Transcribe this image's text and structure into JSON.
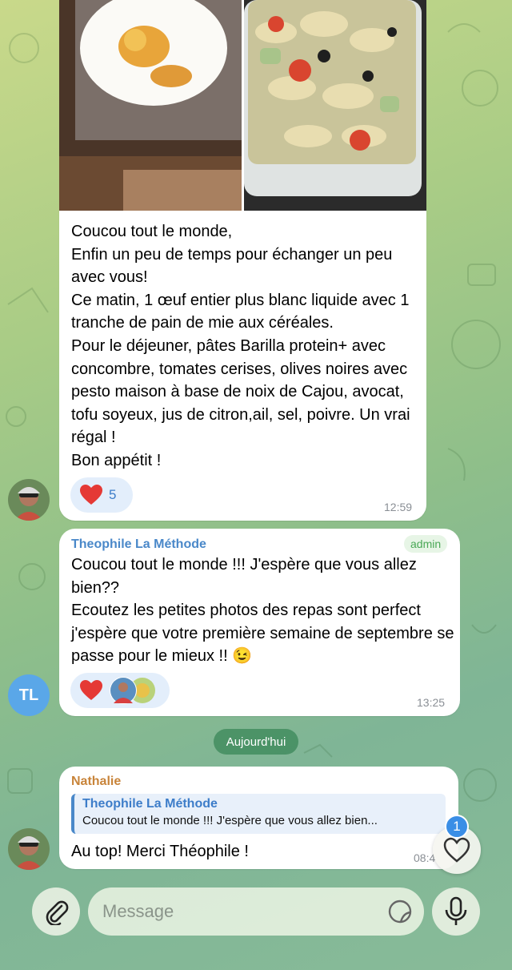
{
  "messages": [
    {
      "id": "m1",
      "text": "Coucou tout le monde,\nEnfin un peu de temps pour  échanger un peu avec vous!\nCe matin, 1 œuf entier plus blanc liquide avec 1 tranche de pain de mie aux céréales.\nPour le déjeuner, pâtes Barilla protein+ avec concombre, tomates cerises, olives noires avec pesto maison à base de noix de Cajou, avocat, tofu soyeux, jus de citron,ail, sel, poivre. Un vrai régal !\nBon appétit !",
      "reaction_count": "5",
      "time": "12:59"
    },
    {
      "id": "m2",
      "sender": "Theophile La Méthode",
      "badge": "admin",
      "text": "Coucou tout le monde !!! J'espère que vous allez bien??\nEcoutez les petites photos des repas sont perfect j'espère que votre première semaine de septembre se passe pour le mieux !! 😉",
      "time": "13:25"
    },
    {
      "id": "m3",
      "sender": "Nathalie",
      "reply_to_name": "Theophile La Méthode",
      "reply_to_text": "Coucou tout le monde !!! J'espère que vous allez bien...",
      "text": "Au top! Merci Théophile !",
      "time": "08:4"
    }
  ],
  "avatar_initials": "TL",
  "date_separator": "Aujourd'hui",
  "reactions_badge": "1",
  "composer": {
    "placeholder": "Message"
  },
  "colors": {
    "accent": "#3a8ee6",
    "sender_theophile": "#4a88c9",
    "sender_nathalie": "#c8843a",
    "admin": "#4aa856",
    "heart": "#e53935"
  }
}
